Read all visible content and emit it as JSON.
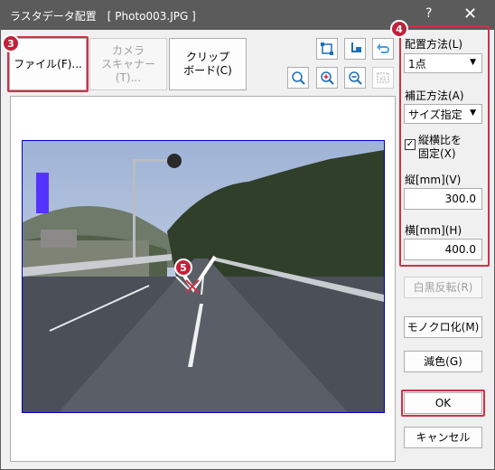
{
  "window": {
    "title": "ラスタデータ配置　[ Photo003.JPG ]",
    "help": "?",
    "close": "✕"
  },
  "toolbar": {
    "file_button": "ファイル(F)...",
    "camera_button": "カメラ\nスキャナー(T)...",
    "clipboard_button": "クリップ\nボード(C)"
  },
  "icons": [
    "fit-page-icon",
    "move-point-icon",
    "undo-icon",
    "zoom-in-icon",
    "zoom-in-plus-icon",
    "zoom-out-icon",
    "actual-size-icon"
  ],
  "markers": {
    "m3": "3",
    "m4": "4",
    "m5": "5"
  },
  "right_panel": {
    "placement_label": "配置方法(L)",
    "placement_value": "1点",
    "correction_label": "補正方法(A)",
    "correction_value": "サイズ指定",
    "fix_ratio_label": "縦横比を\n固定(X)",
    "fix_ratio_checked": true,
    "height_label": "縦[mm](V)",
    "height_value": "300.0",
    "width_label": "横[mm](H)",
    "width_value": "400.0"
  },
  "buttons": {
    "invert": "白黒反転(R)",
    "monochrome": "モノクロ化(M)",
    "reduce": "減色(G)",
    "ok": "OK",
    "cancel": "キャンセル"
  },
  "colors": {
    "titlebar": "#5b5b5b",
    "highlight": "#d32f45",
    "marker": "#c3203a",
    "frame": "#0000cc"
  }
}
